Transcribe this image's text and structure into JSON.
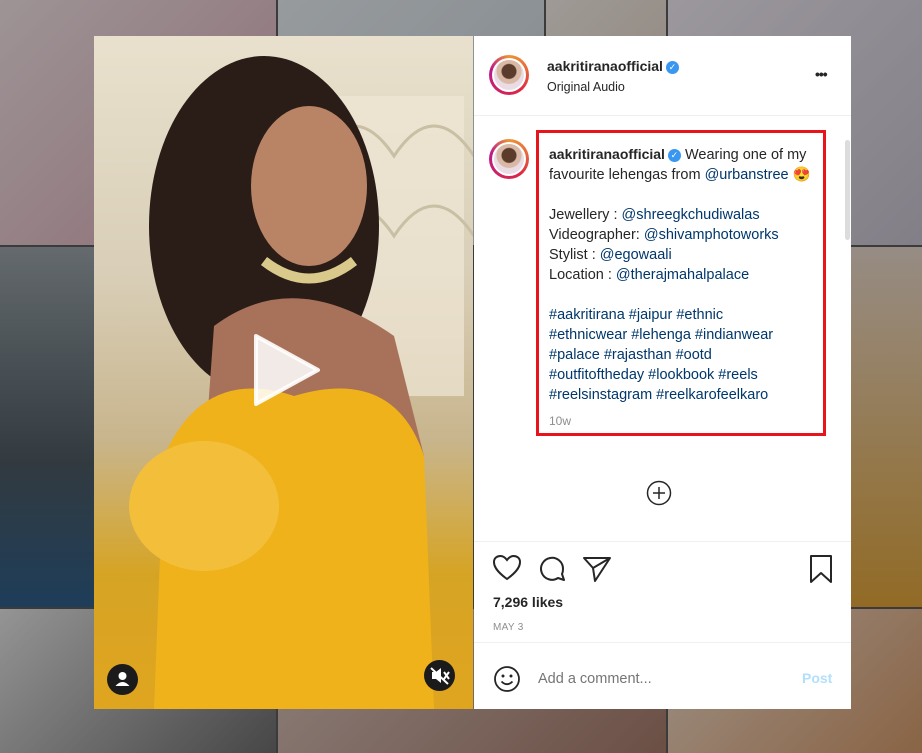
{
  "post": {
    "username": "aakritiranaofficial",
    "audio": "Original Audio",
    "more": "•••",
    "verified_mark": "✓"
  },
  "caption": {
    "username": "aakritiranaofficial",
    "intro": " Wearing one of my favourite lehengas from ",
    "brand": "@urbanstree",
    "emoji": " 😍",
    "credits": [
      {
        "label": "Jewellery : ",
        "handle": "@shreegkchudiwalas"
      },
      {
        "label": "Videographer: ",
        "handle": "@shivamphotoworks"
      },
      {
        "label": "Stylist : ",
        "handle": "@egowaali"
      },
      {
        "label": "Location : ",
        "handle": "@therajmahalpalace"
      }
    ],
    "hashtags": "#aakritirana #jaipur #ethnic #ethnicwear #lehenga #indianwear #palace #rajasthan #ootd #outfitoftheday #lookbook #reels #reelsinstagram #reelkarofeelkaro",
    "age": "10w"
  },
  "stats": {
    "likes": "7,296 likes",
    "date": "MAY 3"
  },
  "comment": {
    "placeholder": "Add a comment...",
    "post_label": "Post"
  },
  "icons": [
    "heart-icon",
    "comment-icon",
    "share-icon",
    "bookmark-icon",
    "add-circle-icon",
    "emoji-icon",
    "play-icon",
    "user-tag-icon",
    "muted-speaker-icon"
  ],
  "colors": {
    "accent_link": "#00376b",
    "post_button": "#b2dffc",
    "highlight_box": "#e8141b",
    "verified": "#3897f0"
  }
}
